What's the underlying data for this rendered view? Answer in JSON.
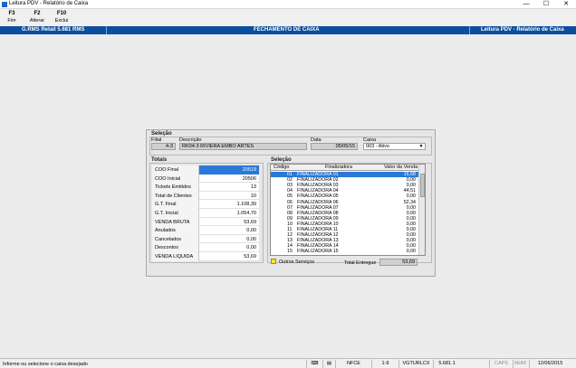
{
  "window": {
    "title": "Leitura PDV - Relatório de Caixa",
    "min": "—",
    "max": "☐",
    "close": "✕"
  },
  "toolbar": [
    {
      "key": "F3",
      "label": "Fim"
    },
    {
      "key": "F2",
      "label": "Alterar"
    },
    {
      "key": "F10",
      "label": "Exclui"
    }
  ],
  "header": {
    "left": "G.RMS Retail 5.681 RMS",
    "center": "FECHAMENTO DE CAIXA",
    "right": "Leitura PDV - Relatório de Caixa"
  },
  "selecao": {
    "title": "Seleção",
    "filial_label": "Filial",
    "filial_value": "4-3",
    "descricao_label": "Descrição",
    "descricao_value": "RK04-3 RIVIERA EMBO ARTES",
    "data_label": "Data",
    "data_value": "05/05/15",
    "caixa_label": "Caixa",
    "caixa_value": "003 - Ativo"
  },
  "totais": {
    "title": "Totais",
    "rows": [
      {
        "label": "COO Final",
        "value": "20519"
      },
      {
        "label": "COO Inicial",
        "value": "20506"
      },
      {
        "label": "Tickets Emitidos",
        "value": "13"
      },
      {
        "label": "Total de Clientes",
        "value": "10"
      },
      {
        "label": "G.T. Final",
        "value": "1.108,39"
      },
      {
        "label": "G.T. Inicial",
        "value": "1.054,70"
      },
      {
        "label": "VENDA BRUTA",
        "value": "53,69"
      },
      {
        "label": "Anulados",
        "value": "0,00"
      },
      {
        "label": "Cancelados",
        "value": "0,00"
      },
      {
        "label": "Descontos",
        "value": "0,00"
      },
      {
        "label": "VENDA LIQUIDA",
        "value": "53,69"
      }
    ]
  },
  "selecao2": {
    "title": "Seleção",
    "columns": [
      "Código",
      "Finalizadora",
      "Valor da Venda"
    ],
    "rows": [
      [
        "01",
        "FINALIZADORA 01",
        "16,68"
      ],
      [
        "02",
        "FINALIZADORA 02",
        "0,00"
      ],
      [
        "03",
        "FINALIZADORA 03",
        "0,00"
      ],
      [
        "04",
        "FINALIZADORA 04",
        "44,51"
      ],
      [
        "05",
        "FINALIZADORA 05",
        "0,00"
      ],
      [
        "06",
        "FINALIZADORA 06",
        "52,34"
      ],
      [
        "07",
        "FINALIZADORA 07",
        "0,00"
      ],
      [
        "08",
        "FINALIZADORA 08",
        "0,00"
      ],
      [
        "09",
        "FINALIZADORA 09",
        "0,00"
      ],
      [
        "10",
        "FINALIZADORA 10",
        "0,00"
      ],
      [
        "11",
        "FINALIZADORA 11",
        "0,00"
      ],
      [
        "12",
        "FINALIZADORA 12",
        "0,00"
      ],
      [
        "13",
        "FINALIZADORA 13",
        "0,00"
      ],
      [
        "14",
        "FINALIZADORA 14",
        "0,00"
      ],
      [
        "15",
        "FINALIZADORA 15",
        "0,00"
      ]
    ],
    "outros_label": "Outros Serviços",
    "total_label": "Total Entregue",
    "total_value": "53,69"
  },
  "status": {
    "message": "Informe ou selecione o caixa desejado",
    "cells": [
      "NFCE",
      "1-9",
      "VGTURLCX",
      "5.681.1",
      "CAPS",
      "NUM",
      "12/06/2015"
    ]
  },
  "colors": {
    "brand_blue": "#0a4fa0",
    "selection": "#2a78d8"
  }
}
